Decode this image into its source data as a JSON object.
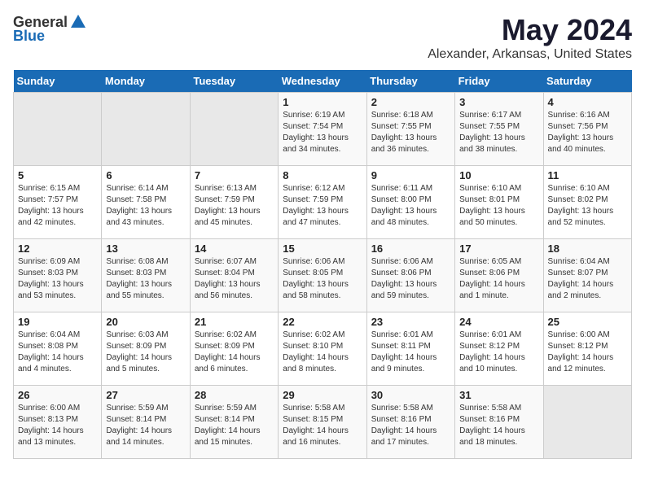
{
  "header": {
    "logo_general": "General",
    "logo_blue": "Blue",
    "title": "May 2024",
    "subtitle": "Alexander, Arkansas, United States"
  },
  "weekdays": [
    "Sunday",
    "Monday",
    "Tuesday",
    "Wednesday",
    "Thursday",
    "Friday",
    "Saturday"
  ],
  "weeks": [
    [
      {
        "day": "",
        "sunrise": "",
        "sunset": "",
        "daylight": ""
      },
      {
        "day": "",
        "sunrise": "",
        "sunset": "",
        "daylight": ""
      },
      {
        "day": "",
        "sunrise": "",
        "sunset": "",
        "daylight": ""
      },
      {
        "day": "1",
        "sunrise": "Sunrise: 6:19 AM",
        "sunset": "Sunset: 7:54 PM",
        "daylight": "Daylight: 13 hours and 34 minutes."
      },
      {
        "day": "2",
        "sunrise": "Sunrise: 6:18 AM",
        "sunset": "Sunset: 7:55 PM",
        "daylight": "Daylight: 13 hours and 36 minutes."
      },
      {
        "day": "3",
        "sunrise": "Sunrise: 6:17 AM",
        "sunset": "Sunset: 7:55 PM",
        "daylight": "Daylight: 13 hours and 38 minutes."
      },
      {
        "day": "4",
        "sunrise": "Sunrise: 6:16 AM",
        "sunset": "Sunset: 7:56 PM",
        "daylight": "Daylight: 13 hours and 40 minutes."
      }
    ],
    [
      {
        "day": "5",
        "sunrise": "Sunrise: 6:15 AM",
        "sunset": "Sunset: 7:57 PM",
        "daylight": "Daylight: 13 hours and 42 minutes."
      },
      {
        "day": "6",
        "sunrise": "Sunrise: 6:14 AM",
        "sunset": "Sunset: 7:58 PM",
        "daylight": "Daylight: 13 hours and 43 minutes."
      },
      {
        "day": "7",
        "sunrise": "Sunrise: 6:13 AM",
        "sunset": "Sunset: 7:59 PM",
        "daylight": "Daylight: 13 hours and 45 minutes."
      },
      {
        "day": "8",
        "sunrise": "Sunrise: 6:12 AM",
        "sunset": "Sunset: 7:59 PM",
        "daylight": "Daylight: 13 hours and 47 minutes."
      },
      {
        "day": "9",
        "sunrise": "Sunrise: 6:11 AM",
        "sunset": "Sunset: 8:00 PM",
        "daylight": "Daylight: 13 hours and 48 minutes."
      },
      {
        "day": "10",
        "sunrise": "Sunrise: 6:10 AM",
        "sunset": "Sunset: 8:01 PM",
        "daylight": "Daylight: 13 hours and 50 minutes."
      },
      {
        "day": "11",
        "sunrise": "Sunrise: 6:10 AM",
        "sunset": "Sunset: 8:02 PM",
        "daylight": "Daylight: 13 hours and 52 minutes."
      }
    ],
    [
      {
        "day": "12",
        "sunrise": "Sunrise: 6:09 AM",
        "sunset": "Sunset: 8:03 PM",
        "daylight": "Daylight: 13 hours and 53 minutes."
      },
      {
        "day": "13",
        "sunrise": "Sunrise: 6:08 AM",
        "sunset": "Sunset: 8:03 PM",
        "daylight": "Daylight: 13 hours and 55 minutes."
      },
      {
        "day": "14",
        "sunrise": "Sunrise: 6:07 AM",
        "sunset": "Sunset: 8:04 PM",
        "daylight": "Daylight: 13 hours and 56 minutes."
      },
      {
        "day": "15",
        "sunrise": "Sunrise: 6:06 AM",
        "sunset": "Sunset: 8:05 PM",
        "daylight": "Daylight: 13 hours and 58 minutes."
      },
      {
        "day": "16",
        "sunrise": "Sunrise: 6:06 AM",
        "sunset": "Sunset: 8:06 PM",
        "daylight": "Daylight: 13 hours and 59 minutes."
      },
      {
        "day": "17",
        "sunrise": "Sunrise: 6:05 AM",
        "sunset": "Sunset: 8:06 PM",
        "daylight": "Daylight: 14 hours and 1 minute."
      },
      {
        "day": "18",
        "sunrise": "Sunrise: 6:04 AM",
        "sunset": "Sunset: 8:07 PM",
        "daylight": "Daylight: 14 hours and 2 minutes."
      }
    ],
    [
      {
        "day": "19",
        "sunrise": "Sunrise: 6:04 AM",
        "sunset": "Sunset: 8:08 PM",
        "daylight": "Daylight: 14 hours and 4 minutes."
      },
      {
        "day": "20",
        "sunrise": "Sunrise: 6:03 AM",
        "sunset": "Sunset: 8:09 PM",
        "daylight": "Daylight: 14 hours and 5 minutes."
      },
      {
        "day": "21",
        "sunrise": "Sunrise: 6:02 AM",
        "sunset": "Sunset: 8:09 PM",
        "daylight": "Daylight: 14 hours and 6 minutes."
      },
      {
        "day": "22",
        "sunrise": "Sunrise: 6:02 AM",
        "sunset": "Sunset: 8:10 PM",
        "daylight": "Daylight: 14 hours and 8 minutes."
      },
      {
        "day": "23",
        "sunrise": "Sunrise: 6:01 AM",
        "sunset": "Sunset: 8:11 PM",
        "daylight": "Daylight: 14 hours and 9 minutes."
      },
      {
        "day": "24",
        "sunrise": "Sunrise: 6:01 AM",
        "sunset": "Sunset: 8:12 PM",
        "daylight": "Daylight: 14 hours and 10 minutes."
      },
      {
        "day": "25",
        "sunrise": "Sunrise: 6:00 AM",
        "sunset": "Sunset: 8:12 PM",
        "daylight": "Daylight: 14 hours and 12 minutes."
      }
    ],
    [
      {
        "day": "26",
        "sunrise": "Sunrise: 6:00 AM",
        "sunset": "Sunset: 8:13 PM",
        "daylight": "Daylight: 14 hours and 13 minutes."
      },
      {
        "day": "27",
        "sunrise": "Sunrise: 5:59 AM",
        "sunset": "Sunset: 8:14 PM",
        "daylight": "Daylight: 14 hours and 14 minutes."
      },
      {
        "day": "28",
        "sunrise": "Sunrise: 5:59 AM",
        "sunset": "Sunset: 8:14 PM",
        "daylight": "Daylight: 14 hours and 15 minutes."
      },
      {
        "day": "29",
        "sunrise": "Sunrise: 5:58 AM",
        "sunset": "Sunset: 8:15 PM",
        "daylight": "Daylight: 14 hours and 16 minutes."
      },
      {
        "day": "30",
        "sunrise": "Sunrise: 5:58 AM",
        "sunset": "Sunset: 8:16 PM",
        "daylight": "Daylight: 14 hours and 17 minutes."
      },
      {
        "day": "31",
        "sunrise": "Sunrise: 5:58 AM",
        "sunset": "Sunset: 8:16 PM",
        "daylight": "Daylight: 14 hours and 18 minutes."
      },
      {
        "day": "",
        "sunrise": "",
        "sunset": "",
        "daylight": ""
      }
    ]
  ]
}
